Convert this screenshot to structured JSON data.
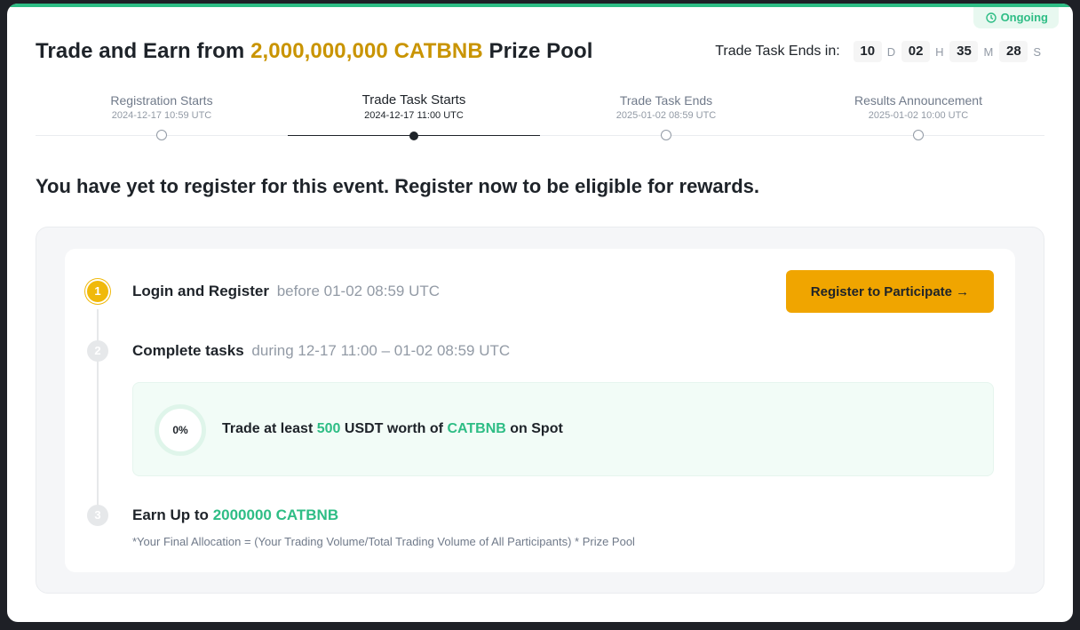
{
  "status": {
    "badge": "Ongoing"
  },
  "header": {
    "title_prefix": "Trade and Earn from",
    "title_highlight": "2,000,000,000 CATBNB",
    "title_suffix": "Prize Pool"
  },
  "countdown": {
    "label": "Trade Task Ends in:",
    "days": "10",
    "days_unit": "D",
    "hours": "02",
    "hours_unit": "H",
    "minutes": "35",
    "minutes_unit": "M",
    "seconds": "28",
    "seconds_unit": "S"
  },
  "timeline": [
    {
      "name": "Registration Starts",
      "date": "2024-12-17 10:59 UTC"
    },
    {
      "name": "Trade Task Starts",
      "date": "2024-12-17 11:00 UTC"
    },
    {
      "name": "Trade Task Ends",
      "date": "2025-01-02 08:59 UTC"
    },
    {
      "name": "Results Announcement",
      "date": "2025-01-02 10:00 UTC"
    }
  ],
  "notice": "You have yet to register for this event. Register now to be eligible for rewards.",
  "steps": {
    "step1": {
      "num": "1",
      "title": "Login and Register",
      "sub": "before 01-02 08:59 UTC"
    },
    "step2": {
      "num": "2",
      "title": "Complete tasks",
      "sub": "during 12-17 11:00 – 01-02 08:59 UTC"
    },
    "step3": {
      "num": "3",
      "title": "Earn Up to",
      "amount": "2000000 CATBNB"
    }
  },
  "register_button": "Register to Participate →",
  "task": {
    "progress": "0%",
    "text_1": "Trade at least",
    "amount": "500",
    "text_2": "USDT worth of",
    "token": "CATBNB",
    "text_3": "on Spot"
  },
  "formula": "*Your Final Allocation = (Your Trading Volume/Total Trading Volume of All Participants) * Prize Pool",
  "colors": {
    "accent": "#f0a500",
    "green": "#2ebd85",
    "gold": "#c99400"
  }
}
